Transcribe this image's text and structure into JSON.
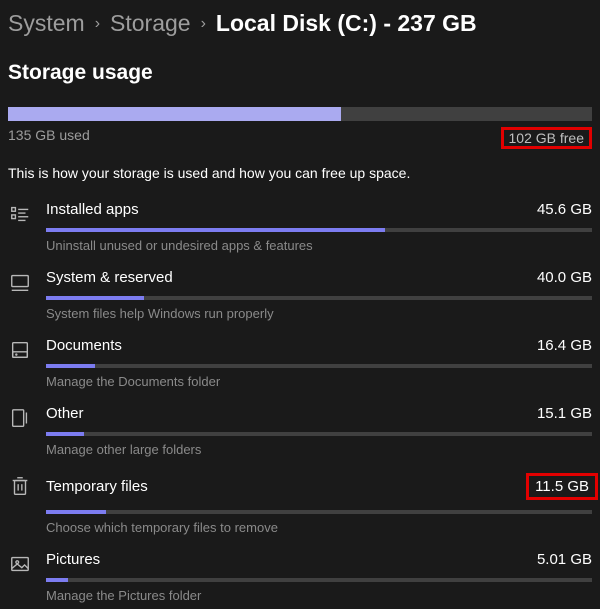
{
  "breadcrumb": {
    "items": [
      "System",
      "Storage"
    ],
    "current": "Local Disk (C:) - 237 GB"
  },
  "section_title": "Storage usage",
  "usage": {
    "used_label": "135 GB used",
    "free_label": "102 GB free",
    "fill_percent": 57
  },
  "hint": "This is how your storage is used and how you can free up space.",
  "categories": [
    {
      "icon": "installed-apps-icon",
      "name": "Installed apps",
      "size": "45.6 GB",
      "fill_percent": 62,
      "desc": "Uninstall unused or undesired apps & features",
      "highlight": false
    },
    {
      "icon": "system-reserved-icon",
      "name": "System & reserved",
      "size": "40.0 GB",
      "fill_percent": 18,
      "desc": "System files help Windows run properly",
      "highlight": false
    },
    {
      "icon": "documents-icon",
      "name": "Documents",
      "size": "16.4 GB",
      "fill_percent": 9,
      "desc": "Manage the Documents folder",
      "highlight": false
    },
    {
      "icon": "other-icon",
      "name": "Other",
      "size": "15.1 GB",
      "fill_percent": 7,
      "desc": "Manage other large folders",
      "highlight": false
    },
    {
      "icon": "temporary-files-icon",
      "name": "Temporary files",
      "size": "11.5 GB",
      "fill_percent": 11,
      "desc": "Choose which temporary files to remove",
      "highlight": true
    },
    {
      "icon": "pictures-icon",
      "name": "Pictures",
      "size": "5.01 GB",
      "fill_percent": 4,
      "desc": "Manage the Pictures folder",
      "highlight": false
    }
  ]
}
